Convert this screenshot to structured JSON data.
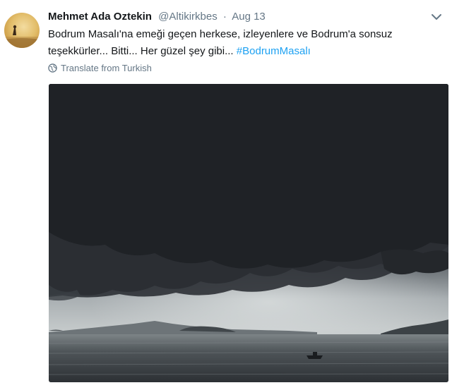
{
  "tweet": {
    "author_name": "Mehmet Ada Oztekin",
    "handle": "@Altikirkbes",
    "separator": "·",
    "date": "Aug 13",
    "text": "Bodrum Masalı'na emeği geçen herkese, izleyenlere ve Bodrum'a sonsuz teşekkürler... Bitti... Her güzel şey gibi...",
    "hashtag": "#BodrumMasalı",
    "translate_label": "Translate from Turkish",
    "icons": {
      "menu": "chevron-down-icon",
      "translate": "globe-icon",
      "avatar": "avatar-icon"
    },
    "colors": {
      "link": "#1da1f2",
      "secondary_text": "#657786",
      "primary_text": "#14171a"
    }
  }
}
